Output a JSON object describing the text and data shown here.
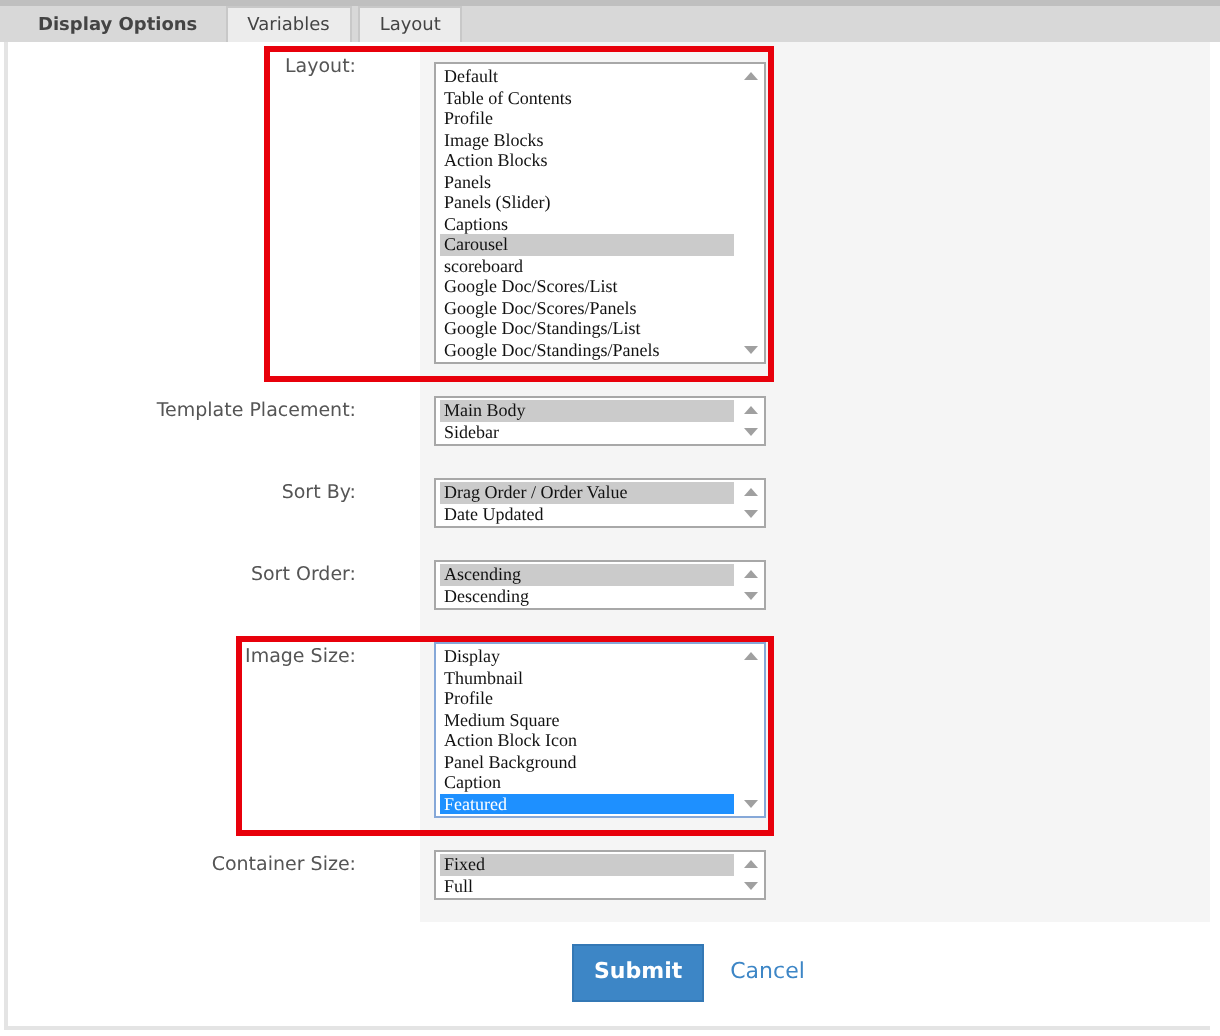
{
  "tabs": [
    {
      "label": "Display Options",
      "selected": true
    },
    {
      "label": "Variables",
      "selected": false
    },
    {
      "label": "Layout",
      "selected": false
    }
  ],
  "fields": [
    {
      "label": "Layout:",
      "highlighted": true,
      "focused": false,
      "options": [
        {
          "text": "Default",
          "selected": false
        },
        {
          "text": "Table of Contents",
          "selected": false
        },
        {
          "text": "Profile",
          "selected": false
        },
        {
          "text": "Image Blocks",
          "selected": false
        },
        {
          "text": "Action Blocks",
          "selected": false
        },
        {
          "text": "Panels",
          "selected": false
        },
        {
          "text": "Panels (Slider)",
          "selected": false
        },
        {
          "text": "Captions",
          "selected": false
        },
        {
          "text": "Carousel",
          "selected": true
        },
        {
          "text": "scoreboard",
          "selected": false
        },
        {
          "text": "Google Doc/Scores/List",
          "selected": false
        },
        {
          "text": "Google Doc/Scores/Panels",
          "selected": false
        },
        {
          "text": "Google Doc/Standings/List",
          "selected": false
        },
        {
          "text": "Google Doc/Standings/Panels",
          "selected": false
        }
      ]
    },
    {
      "label": "Template Placement:",
      "highlighted": false,
      "focused": false,
      "options": [
        {
          "text": "Main Body",
          "selected": true
        },
        {
          "text": "Sidebar",
          "selected": false
        }
      ]
    },
    {
      "label": "Sort By:",
      "highlighted": false,
      "focused": false,
      "options": [
        {
          "text": "Drag Order / Order Value",
          "selected": true
        },
        {
          "text": "Date Updated",
          "selected": false
        }
      ]
    },
    {
      "label": "Sort Order:",
      "highlighted": false,
      "focused": false,
      "options": [
        {
          "text": "Ascending",
          "selected": true
        },
        {
          "text": "Descending",
          "selected": false
        }
      ]
    },
    {
      "label": "Image Size:",
      "highlighted": true,
      "focused": true,
      "options": [
        {
          "text": "Display",
          "selected": false
        },
        {
          "text": "Thumbnail",
          "selected": false
        },
        {
          "text": "Profile",
          "selected": false
        },
        {
          "text": "Medium Square",
          "selected": false
        },
        {
          "text": "Action Block Icon",
          "selected": false
        },
        {
          "text": "Panel Background",
          "selected": false
        },
        {
          "text": "Caption",
          "selected": false
        },
        {
          "text": "Featured",
          "selected": true
        }
      ]
    },
    {
      "label": "Container Size:",
      "highlighted": false,
      "focused": false,
      "options": [
        {
          "text": "Fixed",
          "selected": true
        },
        {
          "text": "Full",
          "selected": false
        }
      ]
    }
  ],
  "buttons": {
    "submit": "Submit",
    "cancel": "Cancel"
  }
}
